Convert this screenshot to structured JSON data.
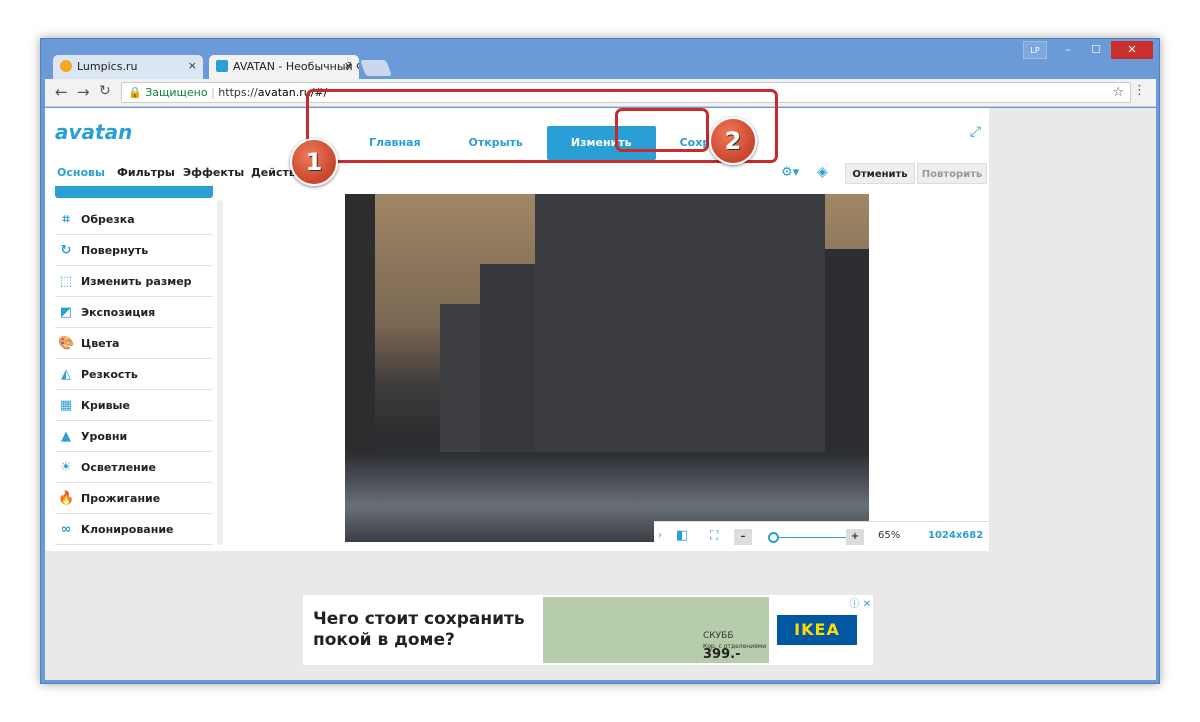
{
  "browser": {
    "tabs": [
      {
        "title": "Lumpics.ru",
        "close": "×"
      },
      {
        "title": "AVATAN - Необычный Ф",
        "close": "×"
      }
    ],
    "window_controls": {
      "user": "LP",
      "minimize": "–",
      "maximize": "☐",
      "close": "✕"
    },
    "address": {
      "secure_label": "Защищено",
      "separator": "|",
      "url_scheme": "https://",
      "url_host": "avatan.ru/#/"
    },
    "icons": {
      "back": "arrow-left-icon",
      "forward": "arrow-right-icon",
      "reload": "reload-icon",
      "bookmark": "star-icon",
      "menu": "kebab-menu-icon"
    }
  },
  "app": {
    "logo": "avatan",
    "top_nav": [
      "Главная",
      "Открыть",
      "Изменить",
      "Сохранить"
    ],
    "active_top_nav": "Изменить",
    "sub_nav": [
      "Основы",
      "Фильтры",
      "Эффекты",
      "Действ"
    ],
    "undo_label": "Отменить",
    "redo_label": "Повторить",
    "tools": [
      "Обрезка",
      "Повернуть",
      "Изменить размер",
      "Экспозиция",
      "Цвета",
      "Резкость",
      "Кривые",
      "Уровни",
      "Осветление",
      "Прожигание",
      "Клонирование"
    ],
    "zoom": {
      "minus": "–",
      "plus": "+",
      "level": "65%",
      "size": "1024x682"
    }
  },
  "ad": {
    "headline": "Чего стоит сохранить покой в доме?",
    "product": "СКУББ",
    "product_sub": "Кор. с отделениями",
    "price": "399.-",
    "brand": "IKEA",
    "close": "ⓘ ✕"
  },
  "annotations": {
    "badge1": "1",
    "badge2": "2"
  },
  "colors": {
    "accent": "#2a9fd6",
    "highlight": "#c72c2c",
    "titlebar": "#6a9ad8"
  }
}
